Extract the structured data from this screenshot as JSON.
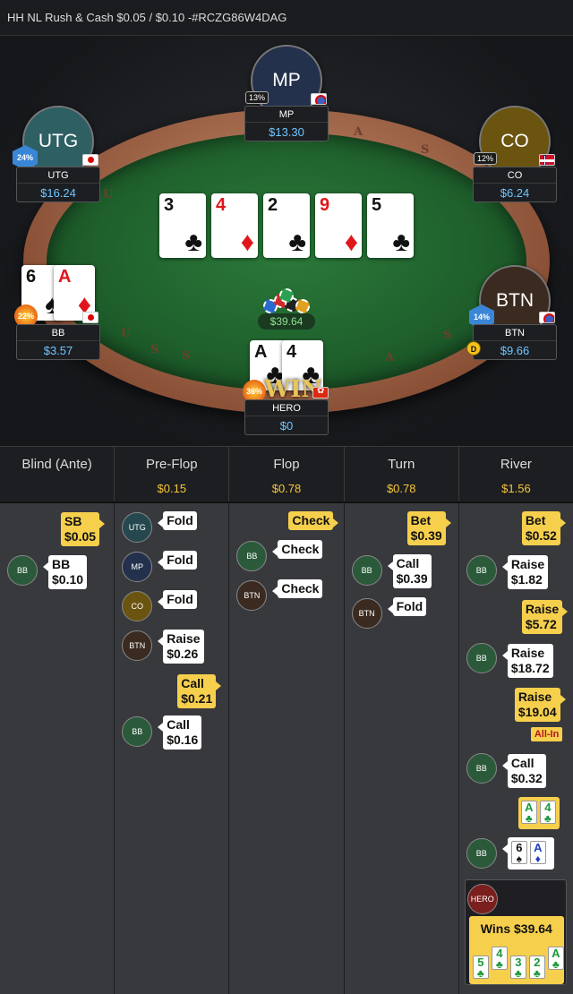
{
  "title": "HH NL Rush & Cash $0.05 / $0.10 -#RCZG86W4DAG",
  "table": {
    "rail_letters": [
      "U",
      "S",
      "A",
      "U",
      "S",
      "A",
      "S",
      "S",
      "A"
    ],
    "seats": [
      {
        "id": "mp",
        "avatar": "MP",
        "name": "MP",
        "stack": "$13.30",
        "pct": "13%",
        "flag": "tw",
        "color": "#24314d"
      },
      {
        "id": "utg",
        "avatar": "UTG",
        "name": "UTG",
        "stack": "$16.24",
        "pct": "24%",
        "flag": "jp",
        "color": "#2e5f63"
      },
      {
        "id": "co",
        "avatar": "CO",
        "name": "CO",
        "stack": "$6.24",
        "pct": "12%",
        "flag": "no",
        "color": "#6a5410"
      },
      {
        "id": "bb",
        "avatar": "BB",
        "name": "BB",
        "stack": "$3.57",
        "pct": "22%",
        "flag": "jp",
        "color": "#2b5a3a"
      },
      {
        "id": "btn",
        "avatar": "BTN",
        "name": "BTN",
        "stack": "$9.66",
        "pct": "14%",
        "flag": "tw",
        "color": "#3a2a20"
      },
      {
        "id": "hero",
        "avatar": "",
        "name": "HERO",
        "stack": "$0",
        "pct": "36%",
        "flag": "hk",
        "color": "#7a1e1e"
      }
    ],
    "board": [
      {
        "rank": "3",
        "suit": "♣",
        "color": "black"
      },
      {
        "rank": "4",
        "suit": "♦",
        "color": "red"
      },
      {
        "rank": "2",
        "suit": "♣",
        "color": "black"
      },
      {
        "rank": "9",
        "suit": "♦",
        "color": "red"
      },
      {
        "rank": "5",
        "suit": "♣",
        "color": "black"
      }
    ],
    "bb_cards": [
      {
        "rank": "6",
        "suit": "♠",
        "color": "black"
      },
      {
        "rank": "A",
        "suit": "♦",
        "color": "red"
      }
    ],
    "hero_cards": [
      {
        "rank": "A",
        "suit": "♣",
        "color": "black"
      },
      {
        "rank": "4",
        "suit": "♣",
        "color": "black"
      }
    ],
    "pot": "$39.64",
    "win_text": "WIN",
    "dealer": "D"
  },
  "history": {
    "columns": [
      {
        "title": "Blind (Ante)",
        "pot": ""
      },
      {
        "title": "Pre-Flop",
        "pot": "$0.15"
      },
      {
        "title": "Flop",
        "pot": "$0.78"
      },
      {
        "title": "Turn",
        "pot": "$0.78"
      },
      {
        "title": "River",
        "pot": "$1.56"
      }
    ],
    "blind": {
      "sb_action": "SB",
      "sb_amount": "$0.05",
      "bb_pos": "BB",
      "bb_action": "BB",
      "bb_amount": "$0.10"
    },
    "preflop": [
      {
        "pos": "UTG",
        "action": "Fold"
      },
      {
        "pos": "MP",
        "action": "Fold"
      },
      {
        "pos": "CO",
        "action": "Fold"
      },
      {
        "pos": "BTN",
        "action": "Raise",
        "amount": "$0.26"
      },
      {
        "hero": true,
        "action": "Call",
        "amount": "$0.21"
      },
      {
        "pos": "BB",
        "action": "Call",
        "amount": "$0.16"
      }
    ],
    "flop": [
      {
        "hero": true,
        "action": "Check"
      },
      {
        "pos": "BB",
        "action": "Check"
      },
      {
        "pos": "BTN",
        "action": "Check"
      }
    ],
    "turn": [
      {
        "hero": true,
        "action": "Bet",
        "amount": "$0.39"
      },
      {
        "pos": "BB",
        "action": "Call",
        "amount": "$0.39"
      },
      {
        "pos": "BTN",
        "action": "Fold"
      }
    ],
    "river": [
      {
        "hero": true,
        "action": "Bet",
        "amount": "$0.52"
      },
      {
        "pos": "BB",
        "action": "Raise",
        "amount": "$1.82"
      },
      {
        "hero": true,
        "action": "Raise",
        "amount": "$5.72"
      },
      {
        "pos": "BB",
        "action": "Raise",
        "amount": "$18.72"
      },
      {
        "hero": true,
        "action": "Raise",
        "amount": "$19.04",
        "allin": "All-In"
      },
      {
        "pos": "BB",
        "action": "Call",
        "amount": "$0.32"
      }
    ],
    "hero_show": [
      {
        "rank": "A",
        "suit": "♣"
      },
      {
        "rank": "4",
        "suit": "♣"
      }
    ],
    "bb_show": [
      {
        "rank": "6",
        "suit": "♠",
        "color": "black"
      },
      {
        "rank": "A",
        "suit": "♦",
        "color": "blue"
      }
    ],
    "winner_pos": "HERO",
    "winner_text": "Wins $39.64",
    "win_cards": [
      {
        "rank": "5",
        "suit": "♣"
      },
      {
        "rank": "4",
        "suit": "♣"
      },
      {
        "rank": "3",
        "suit": "♣"
      },
      {
        "rank": "2",
        "suit": "♣"
      },
      {
        "rank": "A",
        "suit": "♣"
      }
    ]
  }
}
